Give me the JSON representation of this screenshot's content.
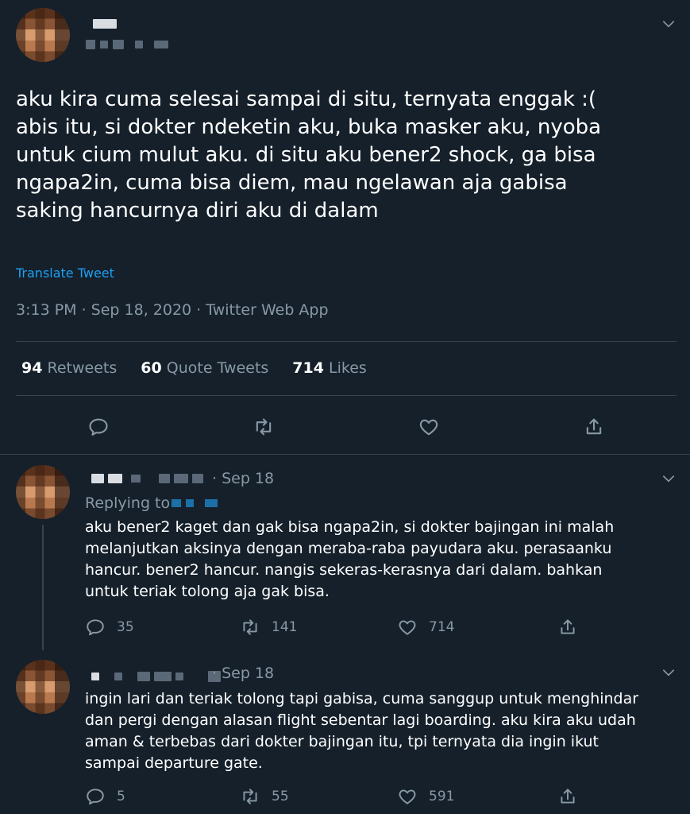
{
  "main_tweet": {
    "text_lines": [
      "aku kira cuma selesai sampai di situ, ternyata enggak :(",
      "abis itu, si dokter ndeketin aku, buka masker aku, nyoba",
      "untuk cium mulut aku. di situ aku bener2 shock, ga bisa",
      "ngapa2in, cuma bisa diem, mau ngelawan aja gabisa",
      "saking hancurnya diri aku di dalam"
    ],
    "translate_label": "Translate Tweet",
    "meta": "3:13 PM · Sep 18, 2020 · Twitter Web App",
    "stats": {
      "retweets_count": "94",
      "retweets_label": "Retweets",
      "quotes_count": "60",
      "quotes_label": "Quote Tweets",
      "likes_count": "714",
      "likes_label": "Likes"
    }
  },
  "replies": [
    {
      "date": "· Sep 18",
      "replying_label": "Replying to",
      "text_lines": [
        "aku bener2 kaget dan gak bisa ngapa2in, si dokter bajingan ini malah",
        "melanjutkan aksinya dengan meraba-raba payudara aku. perasaanku",
        "hancur. bener2 hancur. nangis sekeras-kerasnya dari dalam. bahkan",
        "untuk teriak tolong aja gak bisa."
      ],
      "reply_count": "35",
      "retweet_count": "141",
      "like_count": "714"
    },
    {
      "date": "· Sep 18",
      "text_lines": [
        "ingin lari dan teriak tolong tapi gabisa, cuma sanggup untuk menghindar",
        "dan pergi dengan alasan flight sebentar lagi boarding. aku kira aku udah",
        "aman & terbebas dari dokter bajingan itu, tpi ternyata dia ingin ikut",
        "sampai departure gate."
      ],
      "reply_count": "5",
      "retweet_count": "55",
      "like_count": "591"
    }
  ],
  "colors": {
    "background": "#15202b",
    "secondary_text": "#8899a6",
    "link": "#1da1f2",
    "divider": "#38444d"
  },
  "icons": [
    "comment-icon",
    "retweet-icon",
    "like-icon",
    "share-icon",
    "chevron-down-icon"
  ]
}
